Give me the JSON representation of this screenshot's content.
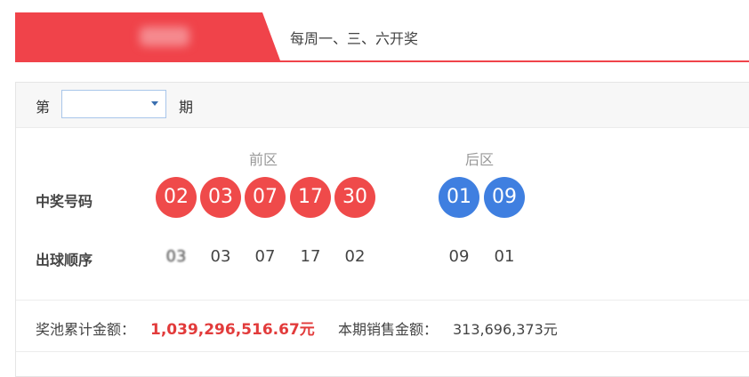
{
  "header": {
    "draw_schedule": "每周一、三、六开奖"
  },
  "issue": {
    "prefix": "第",
    "value": "",
    "suffix": "期"
  },
  "zones": {
    "front": "前区",
    "back": "后区"
  },
  "rows": {
    "winning_label": "中奖号码",
    "order_label": "出球顺序"
  },
  "winning_numbers": {
    "front": [
      "02",
      "03",
      "07",
      "17",
      "30"
    ],
    "back": [
      "01",
      "09"
    ]
  },
  "draw_order": {
    "front": [
      "03",
      "03",
      "07",
      "17",
      "02"
    ],
    "back": [
      "09",
      "01"
    ]
  },
  "pool": {
    "label": "奖池累计金额：",
    "value": "1,039,296,516.67元"
  },
  "sales": {
    "label": "本期销售金额：",
    "value": "313,696,373元"
  },
  "colors": {
    "accent_red": "#f0434a",
    "ball_red": "#ef4a4a",
    "ball_blue": "#3f7fe0"
  }
}
